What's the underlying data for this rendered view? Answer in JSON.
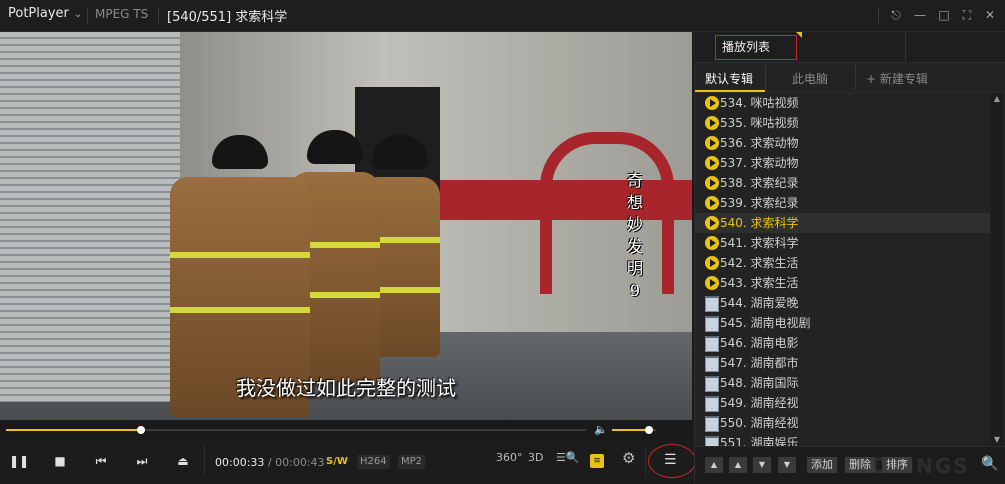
{
  "titlebar": {
    "app_name": "PotPlayer",
    "format": "MPEG TS",
    "title": "[540/551] 求索科学",
    "buttons": [
      "pin-icon",
      "minimize-icon",
      "maximize-icon",
      "restore-icon",
      "close-icon"
    ]
  },
  "video": {
    "subtitle": "我没做过如此完整的测试",
    "vertical_caption": [
      "奇",
      "想",
      "妙",
      "发",
      "明",
      "9"
    ]
  },
  "seek": {
    "progress_fraction": 0.233,
    "volume_fraction": 0.85
  },
  "controls": {
    "time_current": "00:00:33",
    "time_separator": "/",
    "time_total": "00:00:43",
    "sw": "S/W",
    "codec_video": "H264",
    "codec_audio": "MP2",
    "label_360": "360°",
    "label_3d": "3D"
  },
  "playlist": {
    "tab_title": "播放列表",
    "subtabs": [
      "默认专辑",
      "此电脑",
      "+ 新建专辑"
    ],
    "items": [
      {
        "text": "534. 咪咕视频",
        "icon": "play"
      },
      {
        "text": "535. 咪咕视频",
        "icon": "play"
      },
      {
        "text": "536. 求索动物",
        "icon": "play"
      },
      {
        "text": "537. 求索动物",
        "icon": "play"
      },
      {
        "text": "538. 求索纪录",
        "icon": "play"
      },
      {
        "text": "539. 求索纪录",
        "icon": "play"
      },
      {
        "text": "540. 求索科学",
        "icon": "play",
        "selected": true
      },
      {
        "text": "541. 求索科学",
        "icon": "play"
      },
      {
        "text": "542. 求索生活",
        "icon": "play"
      },
      {
        "text": "543. 求索生活",
        "icon": "play"
      },
      {
        "text": "544. 湖南爱晚",
        "icon": "doc"
      },
      {
        "text": "545. 湖南电视剧",
        "icon": "doc"
      },
      {
        "text": "546. 湖南电影",
        "icon": "doc"
      },
      {
        "text": "547. 湖南都市",
        "icon": "doc"
      },
      {
        "text": "548. 湖南国际",
        "icon": "doc"
      },
      {
        "text": "549. 湖南经视",
        "icon": "doc"
      },
      {
        "text": "550. 湖南经视",
        "icon": "doc"
      },
      {
        "text": "551. 湖南娱乐",
        "icon": "doc"
      }
    ],
    "buttons": {
      "add": "添加",
      "delete": "删除",
      "sort": "排序"
    },
    "watermark": "OXINGS"
  }
}
